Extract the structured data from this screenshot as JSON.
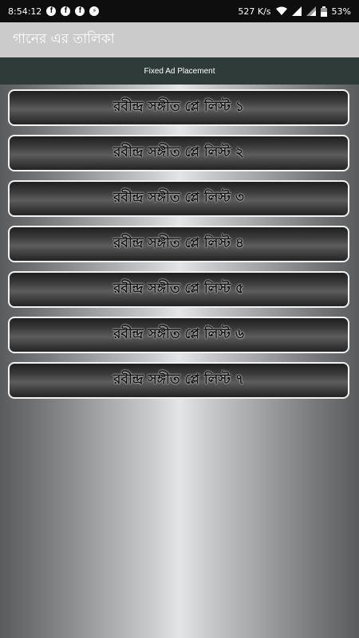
{
  "status": {
    "time": "8:54:12",
    "speed": "527 K/s",
    "battery": "53%"
  },
  "app": {
    "title": "গানের এর তালিকা"
  },
  "ad": {
    "label": "Fixed Ad Placement"
  },
  "playlists": [
    {
      "label": "রবীন্দ্র সঙ্গীত প্লে লিস্ট ১"
    },
    {
      "label": "রবীন্দ্র সঙ্গীত প্লে লিস্ট ২"
    },
    {
      "label": "রবীন্দ্র সঙ্গীত প্লে লিস্ট ৩"
    },
    {
      "label": "রবীন্দ্র সঙ্গীত প্লে লিস্ট ৪"
    },
    {
      "label": "রবীন্দ্র সঙ্গীত প্লে লিস্ট ৫"
    },
    {
      "label": "রবীন্দ্র সঙ্গীত প্লে লিস্ট ৬"
    },
    {
      "label": "রবীন্দ্র সঙ্গীত প্লে লিস্ট ৭"
    }
  ],
  "colors": {
    "status_bar": "#0e0e0e",
    "app_bar": "#cbcbcb",
    "ad_banner": "#2e3b39"
  }
}
